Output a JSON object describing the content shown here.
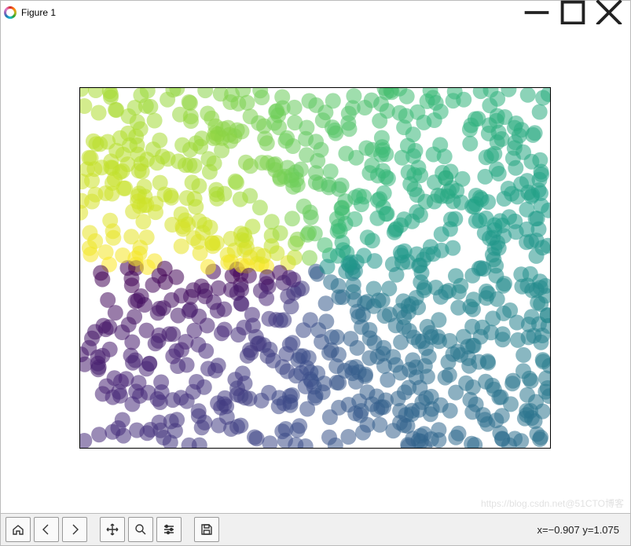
{
  "window": {
    "title": "Figure 1"
  },
  "toolbar": {
    "buttons": [
      {
        "name": "home-button",
        "icon": "home-icon"
      },
      {
        "name": "back-button",
        "icon": "left-arrow-icon"
      },
      {
        "name": "forward-button",
        "icon": "right-arrow-icon"
      },
      {
        "sep": true
      },
      {
        "name": "pan-button",
        "icon": "move-icon"
      },
      {
        "name": "zoom-button",
        "icon": "magnifier-icon"
      },
      {
        "name": "configure-button",
        "icon": "sliders-icon"
      },
      {
        "sep": true
      },
      {
        "name": "save-button",
        "icon": "save-icon"
      }
    ]
  },
  "status": {
    "coord_text": "x=−0.907 y=1.075"
  },
  "watermark": "https://blog.csdn.net@51CTO博客",
  "chart_data": {
    "type": "scatter",
    "title": "",
    "xlabel": "",
    "ylabel": "",
    "xlim": [
      -1,
      1
    ],
    "ylim": [
      -1,
      1
    ],
    "colormap": "viridis",
    "n_points": 1000,
    "point_alpha": 0.55,
    "point_radius_px": 10,
    "generation": "x,y ~ Uniform(-1,1); color = arctan2(y,x)",
    "show_ticks": false,
    "show_grid": false
  }
}
